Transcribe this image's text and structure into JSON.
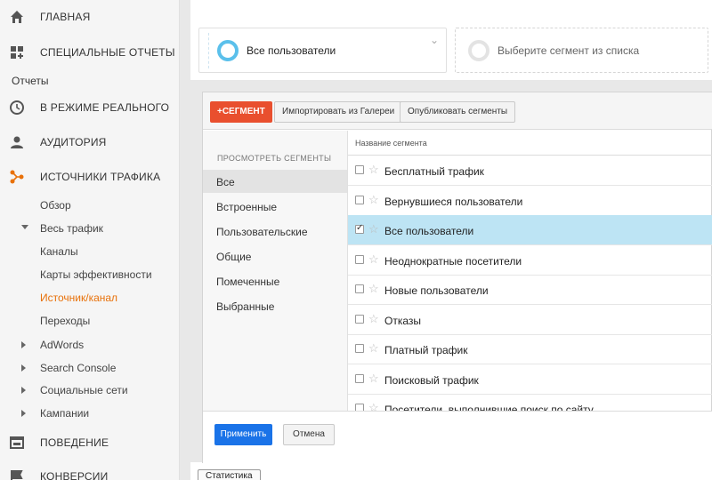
{
  "sidebar": {
    "main_items": [
      {
        "label": "Главная",
        "icon": "home-icon"
      },
      {
        "label": "Специальные отчеты",
        "icon": "custom-reports-icon"
      },
      {
        "label": "В режиме реального",
        "icon": "clock-icon"
      },
      {
        "label": "Аудитория",
        "icon": "person-icon"
      },
      {
        "label": "Источники трафика",
        "icon": "acquisition-icon"
      },
      {
        "label": "Поведение",
        "icon": "behavior-icon"
      },
      {
        "label": "Конверсии",
        "icon": "flag-icon"
      }
    ],
    "reports_label": "Отчеты",
    "sub_items": [
      {
        "label": "Обзор"
      },
      {
        "label": "Весь трафик"
      },
      {
        "label": "Каналы"
      },
      {
        "label": "Карты эффективности"
      },
      {
        "label": "Источник/канал"
      },
      {
        "label": "Переходы"
      },
      {
        "label": "AdWords"
      },
      {
        "label": "Search Console"
      },
      {
        "label": "Социальные сети"
      },
      {
        "label": "Кампании"
      }
    ],
    "active_item": "Источник/канал",
    "accent_color": "#e8710a"
  },
  "segments": {
    "selected": "Все пользователи",
    "placeholder": "Выберите сегмент из списка"
  },
  "toolbar": {
    "new_segment": "+СЕГМЕНТ",
    "import": "Импортировать из Галереи",
    "publish": "Опубликовать сегменты"
  },
  "left_panel": {
    "header": "Просмотреть сегменты",
    "items": [
      "Все",
      "Встроенные",
      "Пользовательские",
      "Общие",
      "Помеченные",
      "Выбранные"
    ],
    "selected": "Все"
  },
  "table": {
    "column_header": "Название сегмента",
    "rows": [
      {
        "label": "Бесплатный трафик",
        "checked": false
      },
      {
        "label": "Вернувшиеся пользователи",
        "checked": false
      },
      {
        "label": "Все пользователи",
        "checked": true
      },
      {
        "label": "Неоднократные посетители",
        "checked": false
      },
      {
        "label": "Новые пользователи",
        "checked": false
      },
      {
        "label": "Отказы",
        "checked": false
      },
      {
        "label": "Платный трафик",
        "checked": false
      },
      {
        "label": "Поисковый трафик",
        "checked": false
      },
      {
        "label": "Посетители, выполнившие поиск по сайту",
        "checked": false
      }
    ]
  },
  "footer": {
    "apply": "Применить",
    "cancel": "Отмена"
  },
  "bottom_tab": "Статистика",
  "colors": {
    "segment_button": "#e94f2e",
    "apply_button": "#1a73e8",
    "selected_row": "#bde4f4",
    "segment_ring": "#5bc0eb"
  }
}
